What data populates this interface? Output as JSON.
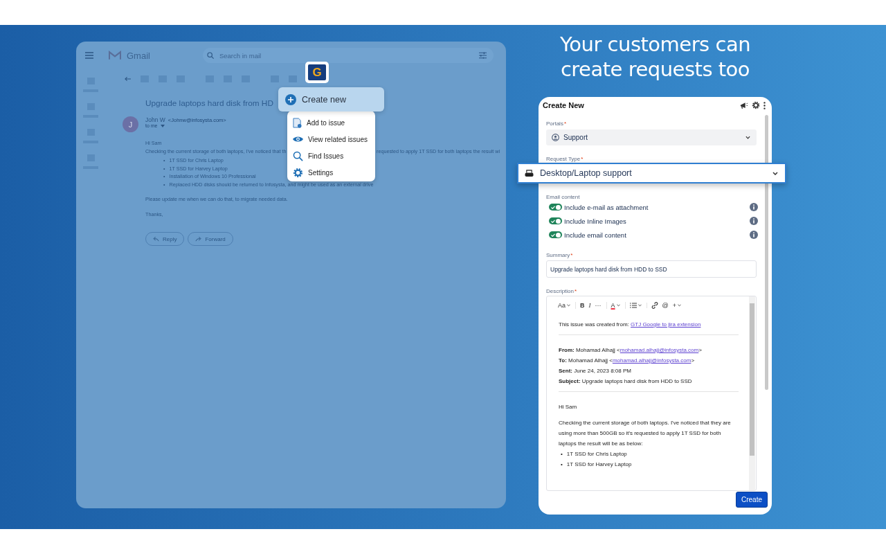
{
  "headline": "Your customers can create requests too",
  "gmail": {
    "app_name": "Gmail",
    "search_placeholder": "Search in mail",
    "subject": "Upgrade laptops hard disk from HD",
    "sender": "John W",
    "sender_email": "<Johnw@infosysta.com>",
    "avatar": "J",
    "recipient": "to me",
    "greeting": "Hi Sam",
    "bullet_mark": "•",
    "body_parts": [
      "Checking the current storage of both laptops, I've noticed that th",
      "requested to apply 1T SSD for both laptops the result wi"
    ],
    "bullets": [
      "1T SSD for Chris Laptop",
      "1T SSD for Harvey Laptop",
      "Installation of Windows 10 Professional",
      "Replaced HDD disks should be returned to Infosysta, and might be used as an external drive"
    ],
    "closing": [
      "Please update me when we can do that, to migrate needed data.",
      "Thanks,"
    ],
    "buttons": [
      {
        "label": "Reply",
        "kind": "reply"
      },
      {
        "label": "Forward",
        "kind": "forward"
      }
    ]
  },
  "extension": {
    "logo": "G",
    "menu": [
      {
        "label": "Create new",
        "kind": "primary",
        "selected": true
      },
      {
        "label": "Add to issue",
        "kind": "item",
        "selected": false
      },
      {
        "label": "View related issues",
        "kind": "item",
        "selected": false
      },
      {
        "label": "Find Issues",
        "kind": "item",
        "selected": false
      },
      {
        "label": "Settings",
        "kind": "item",
        "selected": false
      }
    ]
  },
  "form": {
    "title": "Create New",
    "required_mark": "*",
    "bullet_mark": "•",
    "portal": {
      "label": "Portals",
      "required": true,
      "value": "Support"
    },
    "request_type": {
      "label": "Request Type",
      "required": true,
      "value": "Desktop/Laptop support"
    },
    "email_content": {
      "label": "Email content",
      "options": [
        {
          "label": "Include e-mail as attachment",
          "on": true
        },
        {
          "label": "Include Inline Images",
          "on": true
        },
        {
          "label": "Include email content",
          "on": true
        }
      ]
    },
    "summary": {
      "label": "Summary",
      "required": true,
      "value": "Upgrade laptops hard disk from HDD to SSD"
    },
    "description": {
      "label": "Description",
      "required": true,
      "toolbar": [
        {
          "kind": "text",
          "label": "Aa",
          "caret": true,
          "separator_after": true
        },
        {
          "kind": "bold",
          "label": "B",
          "caret": false,
          "separator_after": false
        },
        {
          "kind": "italic",
          "label": "I",
          "caret": false,
          "separator_after": false
        },
        {
          "kind": "text",
          "label": "···",
          "caret": false,
          "separator_after": true
        },
        {
          "kind": "color",
          "label": "A",
          "caret": true,
          "separator_after": true
        },
        {
          "kind": "list",
          "caret": true,
          "separator_after": true
        },
        {
          "kind": "link",
          "caret": false,
          "separator_after": false
        },
        {
          "kind": "text",
          "label": "@",
          "caret": false,
          "separator_after": false
        },
        {
          "kind": "text",
          "label": "+",
          "caret": true,
          "separator_after": false
        }
      ],
      "intro": "This issue was created from: ",
      "intro_link": "GTJ Google to jira extension",
      "headers": [
        {
          "label": "From:",
          "text": " Mohamad Alhajj <",
          "link": "mohamad.alhajj@infosysta.com",
          "after": ">"
        },
        {
          "label": "To:",
          "text": " Mohamad Alhajj <",
          "link": "mohamad.alhajj@infosysta.com",
          "after": ">"
        },
        {
          "label": "Sent:",
          "text": " June 24, 2023 8:08 PM"
        },
        {
          "label": "Subject:",
          "text": " Upgrade laptops hard disk from HDD to SSD"
        }
      ],
      "greeting": "Hi Sam",
      "paragraph": "Checking the current storage of both laptops. I've noticed that they are using more than 500GB so it's requested to apply 1T SSD for both laptops the result will be as below:",
      "bullets": [
        "1T SSD for Chris Laptop",
        "1T SSD for Harvey Laptop"
      ]
    },
    "submit": "Create"
  }
}
